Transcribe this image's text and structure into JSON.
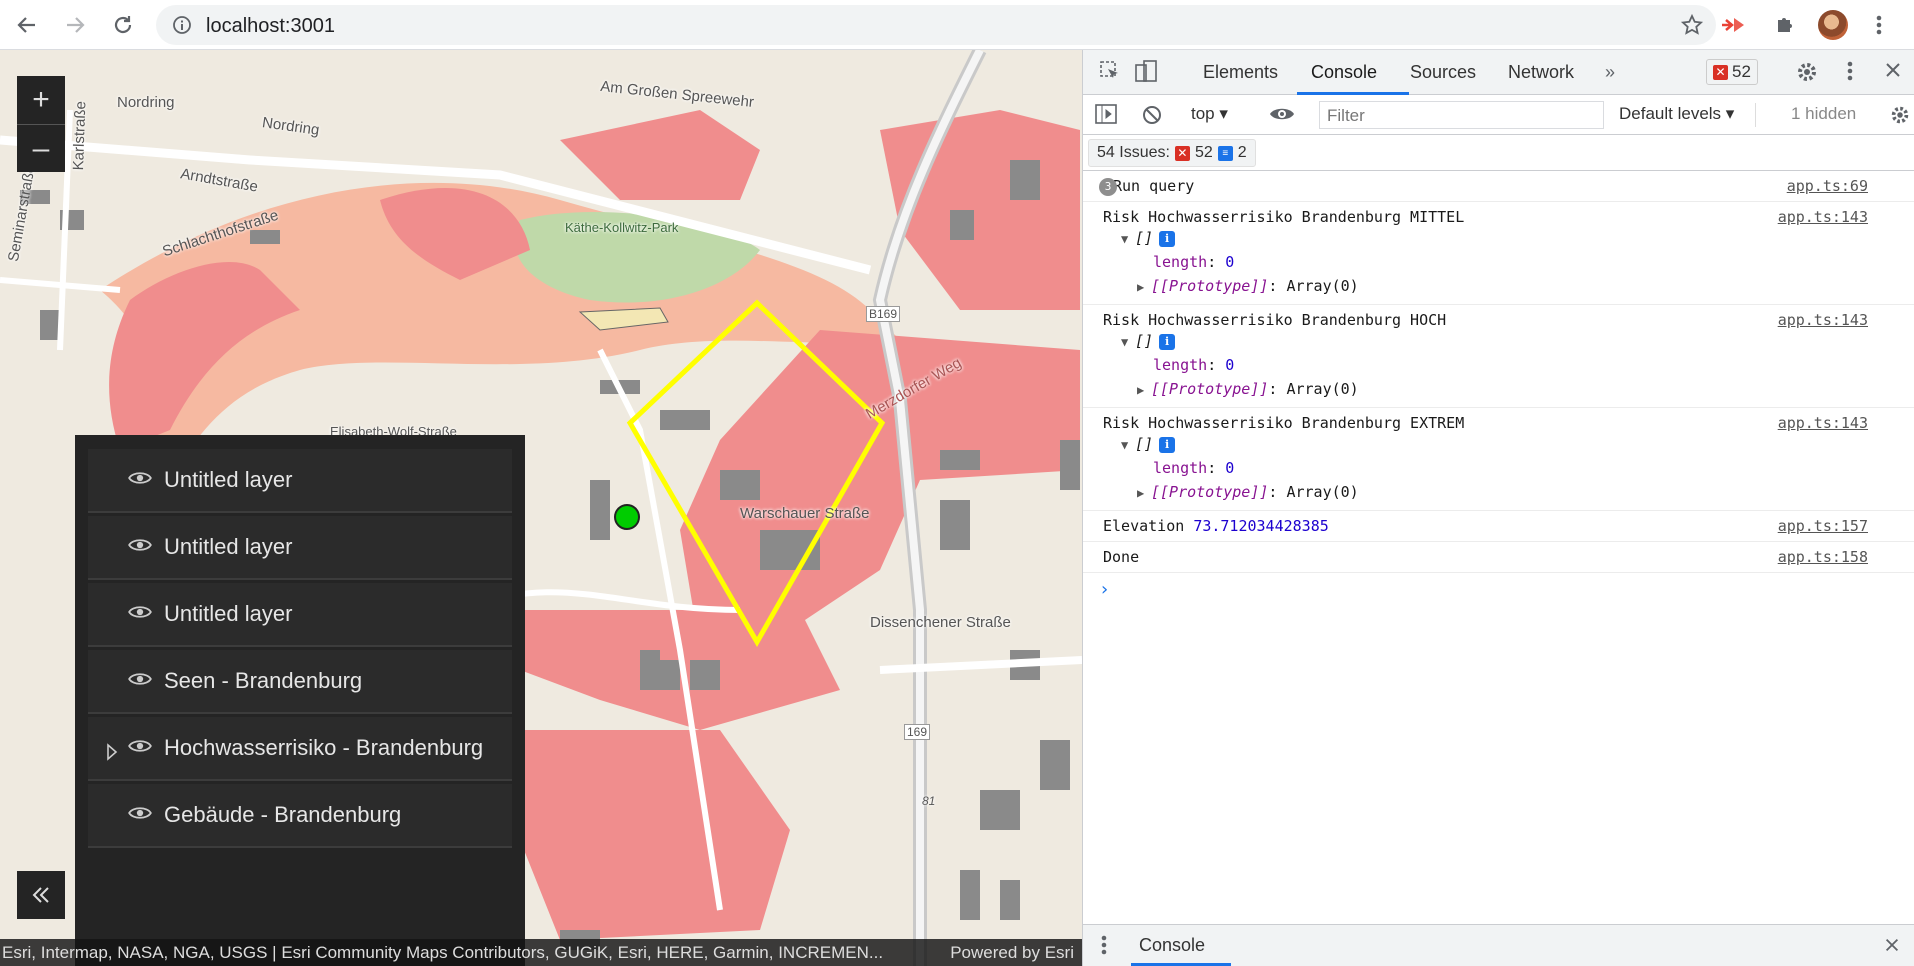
{
  "browser": {
    "url": "localhost:3001",
    "icons": [
      "back-arrow-icon",
      "forward-arrow-icon",
      "reload-icon",
      "info-icon",
      "star-icon",
      "extension-icon",
      "puzzle-icon",
      "avatar"
    ]
  },
  "map": {
    "streets": [
      "Nordring",
      "Nordring",
      "Am Großen Spreewehr",
      "Karlstraße",
      "Seminarstraße",
      "Arndtstraße",
      "Schlachthofstraße",
      "Käthe-Kollwitz-Park",
      "B169",
      "Merzdorfer Weg",
      "Warschauer Straße",
      "Dissenchener Straße",
      "169",
      "81",
      "Elisabeth-Wolf-Straße"
    ],
    "zoom_in": "+",
    "zoom_out": "–",
    "attribution": "Esri, Intermap, NASA, NGA, USGS | Esri Community Maps Contributors, GUGiK, Esri, HERE, Garmin, INCREMEN...",
    "powered": "Powered by Esri",
    "marker_color": "#00cc00",
    "polygon_color": "#ffff00",
    "flood_color": "#f08d8d"
  },
  "layers": [
    {
      "title": "Untitled layer",
      "expandable": false
    },
    {
      "title": "Untitled layer",
      "expandable": false
    },
    {
      "title": "Untitled layer",
      "expandable": false
    },
    {
      "title": "Seen - Brandenburg",
      "expandable": false
    },
    {
      "title": "Hochwasserrisiko - Brandenburg",
      "expandable": true
    },
    {
      "title": "Gebäude - Brandenburg",
      "expandable": false
    }
  ],
  "devtools": {
    "tabs": [
      "Elements",
      "Console",
      "Sources",
      "Network"
    ],
    "active_tab": "Console",
    "error_count": "52",
    "context": "top",
    "filter_placeholder": "Filter",
    "levels": "Default levels",
    "hidden": "1 hidden",
    "issues": {
      "label": "54 Issues:",
      "errors": "52",
      "messages": "2"
    },
    "drawer_tab": "Console",
    "messages": [
      {
        "type": "group",
        "count": "3",
        "text": "Run query",
        "src": "app.ts:69"
      },
      {
        "type": "array",
        "text": "Risk Hochwasserrisiko Brandenburg MITTEL",
        "src": "app.ts:143",
        "arr": "[]",
        "length_key": "length",
        "length_val": "0",
        "proto": "[[Prototype]]",
        "proto_val": "Array(0)"
      },
      {
        "type": "array",
        "text": "Risk Hochwasserrisiko Brandenburg HOCH",
        "src": "app.ts:143",
        "arr": "[]",
        "length_key": "length",
        "length_val": "0",
        "proto": "[[Prototype]]",
        "proto_val": "Array(0)"
      },
      {
        "type": "array",
        "text": "Risk Hochwasserrisiko Brandenburg EXTREM",
        "src": "app.ts:143",
        "arr": "[]",
        "length_key": "length",
        "length_val": "0",
        "proto": "[[Prototype]]",
        "proto_val": "Array(0)"
      },
      {
        "type": "value",
        "text": "Elevation",
        "value": "73.712034428385",
        "src": "app.ts:157"
      },
      {
        "type": "plain",
        "text": "Done",
        "src": "app.ts:158"
      }
    ]
  }
}
